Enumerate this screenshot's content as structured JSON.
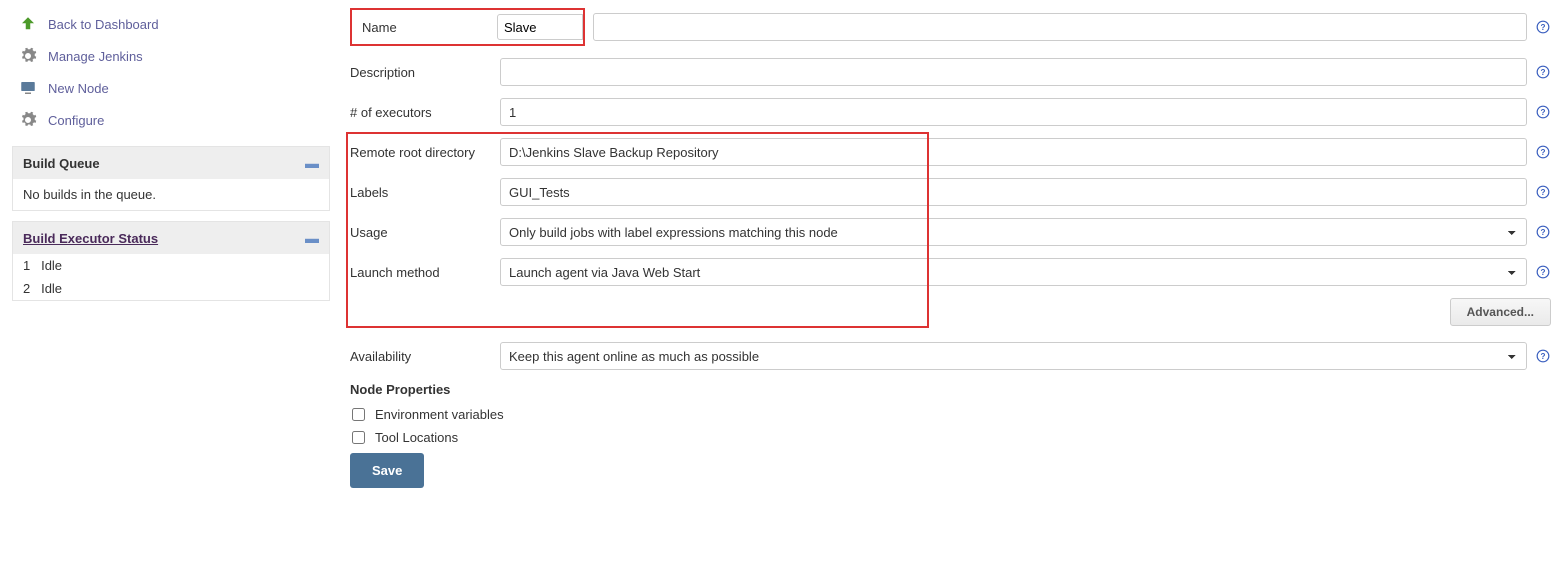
{
  "sidebar": {
    "links": [
      {
        "label": "Back to Dashboard"
      },
      {
        "label": "Manage Jenkins"
      },
      {
        "label": "New Node"
      },
      {
        "label": "Configure"
      }
    ],
    "buildQueue": {
      "title": "Build Queue",
      "empty": "No builds in the queue."
    },
    "execStatus": {
      "title": "Build Executor Status",
      "rows": [
        {
          "num": "1",
          "state": "Idle"
        },
        {
          "num": "2",
          "state": "Idle"
        }
      ]
    }
  },
  "form": {
    "nameLabel": "Name",
    "nameValue": "Slave",
    "descLabel": "Description",
    "descValue": "",
    "executorsLabel": "# of executors",
    "executorsValue": "1",
    "remoteLabel": "Remote root directory",
    "remoteValue": "D:\\Jenkins Slave Backup Repository",
    "labelsLabel": "Labels",
    "labelsValue": "GUI_Tests",
    "usageLabel": "Usage",
    "usageValue": "Only build jobs with label expressions matching this node",
    "launchLabel": "Launch method",
    "launchValue": "Launch agent via Java Web Start",
    "advanced": "Advanced...",
    "availLabel": "Availability",
    "availValue": "Keep this agent online as much as possible",
    "nodePropsTitle": "Node Properties",
    "envVars": "Environment variables",
    "toolLoc": "Tool Locations",
    "save": "Save"
  }
}
